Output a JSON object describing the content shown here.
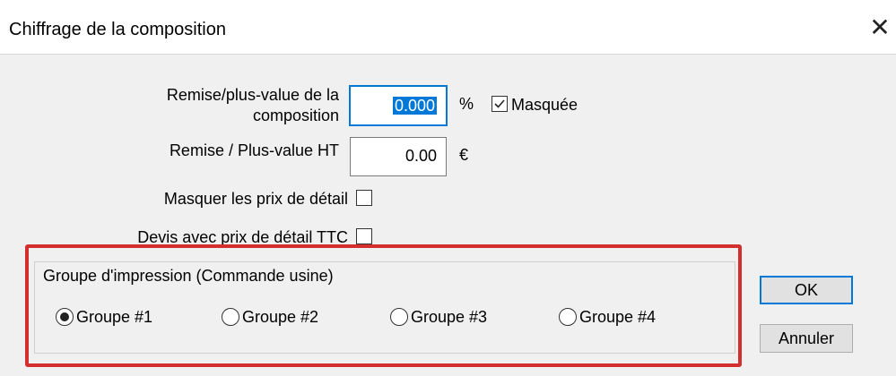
{
  "window": {
    "title": "Chiffrage de la composition",
    "close_glyph": "✕"
  },
  "form": {
    "remise_label_line1": "Remise/plus-value de la",
    "remise_label_line2": "composition",
    "remise_value": "0.000",
    "remise_unit": "%",
    "masquee_label": "Masquée",
    "masquee_checked": true,
    "remise_ht_label": "Remise / Plus-value HT",
    "remise_ht_value": "0.00",
    "remise_ht_unit": "€",
    "masquer_prix_label": "Masquer les prix de détail",
    "masquer_prix_checked": false,
    "devis_ttc_label": "Devis avec prix de détail TTC",
    "devis_ttc_checked": false
  },
  "groupe": {
    "legend": "Groupe d'impression (Commande usine)",
    "options": [
      {
        "label": "Groupe #1",
        "selected": true
      },
      {
        "label": "Groupe #2",
        "selected": false
      },
      {
        "label": "Groupe #3",
        "selected": false
      },
      {
        "label": "Groupe #4",
        "selected": false
      }
    ]
  },
  "buttons": {
    "ok": "OK",
    "cancel": "Annuler"
  },
  "colors": {
    "accent": "#0078d7",
    "highlight": "#d32f2f",
    "background": "#f0f0f0"
  }
}
